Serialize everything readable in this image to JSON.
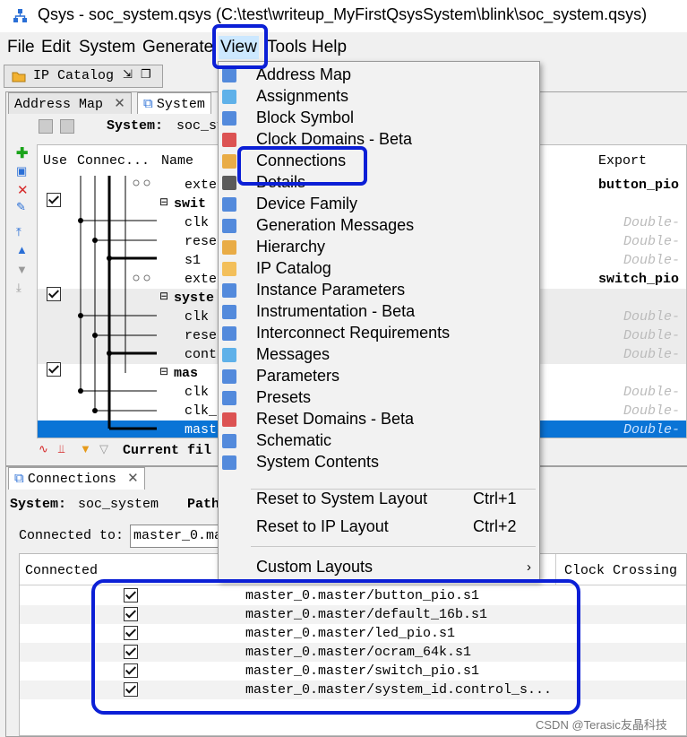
{
  "window": {
    "title": "Qsys - soc_system.qsys (C:\\test\\writeup_MyFirstQsysSystem\\blink\\soc_system.qsys)"
  },
  "menubar": {
    "items": [
      "File",
      "Edit",
      "System",
      "Generate",
      "View",
      "Tools",
      "Help"
    ],
    "active": "View"
  },
  "ip_catalog_tab": {
    "label": "IP Catalog"
  },
  "top_pane": {
    "tabs": [
      "Address Map",
      "System"
    ],
    "system_label": "System:",
    "system_value": "soc_sy",
    "columns": [
      "Use",
      "Connec...",
      "Name",
      "Export"
    ],
    "rows": [
      {
        "name": "exte",
        "export": "button_pio"
      },
      {
        "name": "swit",
        "export": ""
      },
      {
        "name": "clk",
        "export": "Double-"
      },
      {
        "name": "rese",
        "export": "Double-"
      },
      {
        "name": "s1",
        "export": "Double-"
      },
      {
        "name": "exte",
        "export": "switch_pio"
      },
      {
        "name": "syste",
        "export": ""
      },
      {
        "name": "clk",
        "export": "Double-"
      },
      {
        "name": "rese",
        "export": "Double-"
      },
      {
        "name": "cont",
        "export": "Double-"
      },
      {
        "name": "mas",
        "export": ""
      },
      {
        "name": "clk",
        "export": "Double-"
      },
      {
        "name": "clk_",
        "export": "Double-"
      },
      {
        "name": "mast",
        "export": "Double-"
      }
    ],
    "footer": "Current fil"
  },
  "connections_pane": {
    "tab": "Connections",
    "system_label": "System:",
    "system_value": "soc_system",
    "path_label": "Path",
    "connected_to_label": "Connected to:",
    "connected_to_value": "master_0.ma",
    "columns": [
      "Connected",
      "Clock Crossing"
    ],
    "rows": [
      {
        "connected": true,
        "path": "master_0.master/button_pio.s1"
      },
      {
        "connected": true,
        "path": "master_0.master/default_16b.s1"
      },
      {
        "connected": true,
        "path": "master_0.master/led_pio.s1"
      },
      {
        "connected": true,
        "path": "master_0.master/ocram_64k.s1"
      },
      {
        "connected": true,
        "path": "master_0.master/switch_pio.s1"
      },
      {
        "connected": true,
        "path": "master_0.master/system_id.control_s..."
      }
    ]
  },
  "view_menu": {
    "items": [
      "Address Map",
      "Assignments",
      "Block Symbol",
      "Clock Domains - Beta",
      "Connections",
      "Details",
      "Device Family",
      "Generation Messages",
      "Hierarchy",
      "IP Catalog",
      "Instance Parameters",
      "Instrumentation - Beta",
      "Interconnect Requirements",
      "Messages",
      "Parameters",
      "Presets",
      "Reset Domains - Beta",
      "Schematic",
      "System Contents"
    ],
    "layout_items": [
      {
        "label": "Reset to System Layout",
        "shortcut": "Ctrl+1"
      },
      {
        "label": "Reset to IP Layout",
        "shortcut": "Ctrl+2"
      }
    ],
    "custom_layouts": "Custom Layouts"
  },
  "watermark": "CSDN @Terasic友晶科技",
  "colors": {
    "highlight_box": "#0b1fd6",
    "selection": "#0a74d6",
    "menu_active": "#cce8ff"
  }
}
